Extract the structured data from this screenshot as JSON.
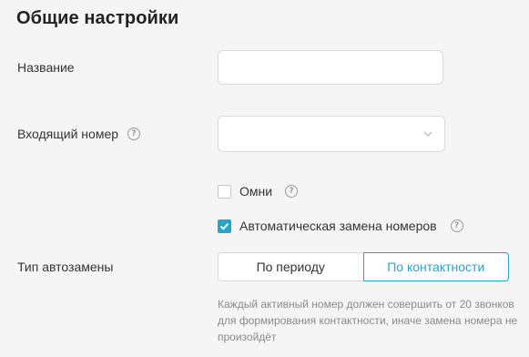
{
  "section": {
    "title": "Общие настройки"
  },
  "fields": {
    "name": {
      "label": "Название",
      "value": "",
      "placeholder": ""
    },
    "incoming_number": {
      "label": "Входящий номер",
      "help_icon": "question-circle-icon",
      "selected_value": ""
    },
    "omni": {
      "label": "Омни",
      "checked": false,
      "help_icon": "question-circle-icon"
    },
    "auto_replace": {
      "label": "Автоматическая замена номеров",
      "checked": true,
      "help_icon": "question-circle-icon"
    },
    "replace_type": {
      "label": "Тип автозамены",
      "options": [
        "По периоду",
        "По контактности"
      ],
      "selected": "По контактности",
      "hint": "Каждый активный номер должен совершить от 20 звонков для формирования контактности, иначе замена номера не произойдёт"
    }
  },
  "colors": {
    "accent": "#2aa3c8",
    "background": "#f5f5f5",
    "border": "#d9d9d9",
    "hint_text": "#8a8a8a"
  }
}
